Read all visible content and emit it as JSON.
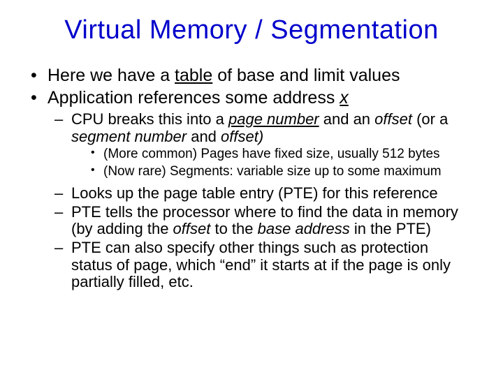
{
  "title": "Virtual Memory / Segmentation",
  "b1": {
    "pre": "Here we have a ",
    "table": "table",
    "post": " of base and limit values"
  },
  "b2": {
    "pre": "Application references some address ",
    "x": "x"
  },
  "s1": {
    "a": "CPU breaks this into a ",
    "pn": "page number",
    "b": " and an ",
    "off": "offset",
    "c": " (or a ",
    "seg": "segment number",
    "d": " and ",
    "off2": "offset)"
  },
  "t1": "(More common) Pages have fixed size, usually 512 bytes",
  "t2": "(Now rare) Segments: variable size up to some maximum",
  "s2": "Looks up the page table entry (PTE) for this reference",
  "s3": {
    "a": "PTE tells the processor where to find the data in memory (by adding the ",
    "off": "offset",
    "b": " to the ",
    "base": "base address",
    "c": " in the PTE)"
  },
  "s4": "PTE can also specify other things such as protection status of page, which “end” it starts at if the page is only partially filled, etc."
}
